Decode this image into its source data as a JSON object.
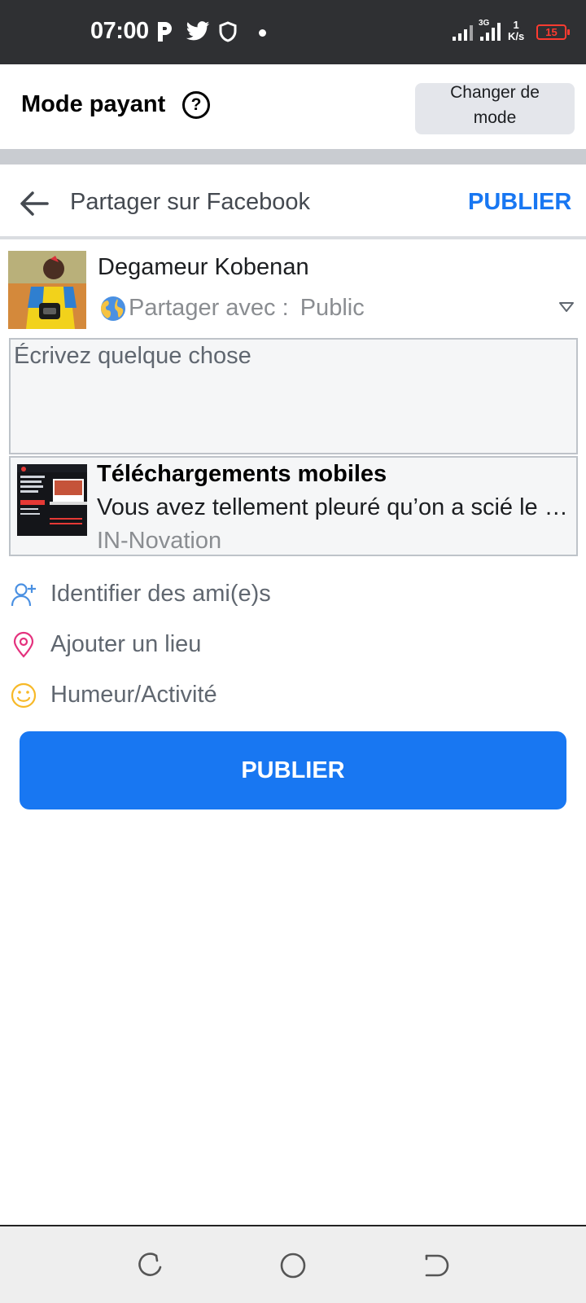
{
  "status_bar": {
    "time": "07:00",
    "network_speed_value": "1",
    "network_speed_unit": "K/s",
    "battery": "15",
    "icons": [
      "p-icon",
      "twitter-icon",
      "shield-icon",
      "signal-icon",
      "signal-3g-icon"
    ]
  },
  "mode_bar": {
    "title": "Mode payant",
    "help_symbol": "?",
    "change_mode_label_line1": "Changer de",
    "change_mode_label_line2": "mode"
  },
  "header": {
    "title": "Partager sur Facebook",
    "publish_label": "PUBLIER"
  },
  "profile": {
    "name": "Degameur Kobenan",
    "share_with_label": "Partager avec :",
    "audience": "Public"
  },
  "composer": {
    "placeholder": "Écrivez quelque chose",
    "value": ""
  },
  "link_card": {
    "title": "Téléchargements mobiles",
    "description": "Vous avez tellement pleuré qu’on a scié le prix en deux",
    "source": "IN-Novation"
  },
  "options": [
    {
      "label": "Identifier des ami(e)s",
      "icon": "add-friend-icon"
    },
    {
      "label": "Ajouter un lieu",
      "icon": "location-pin-icon"
    },
    {
      "label": "Humeur/Activité",
      "icon": "smiley-icon"
    }
  ],
  "publish_button_label": "PUBLIER",
  "colors": {
    "brand_blue": "#1877f2",
    "status_bar": "#2f3033",
    "battery_low": "#ff3b30",
    "pin_pink": "#e4317d",
    "smiley_yellow": "#f7b928"
  }
}
